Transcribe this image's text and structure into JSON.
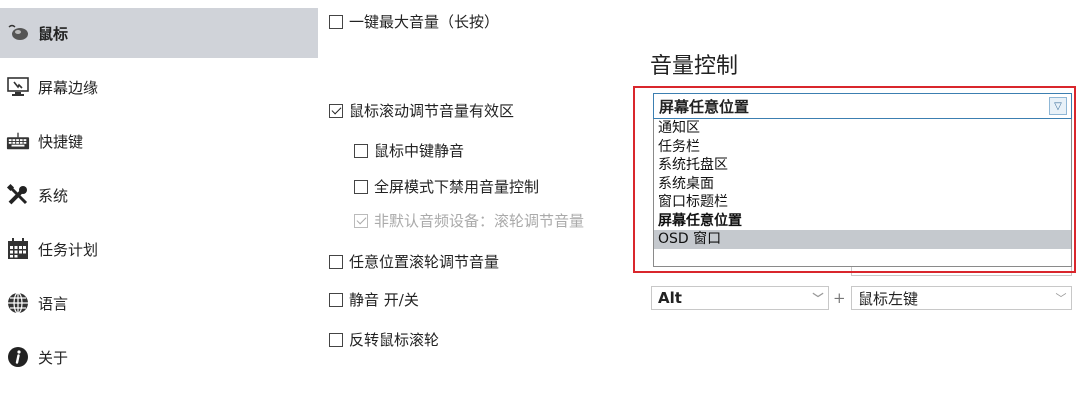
{
  "sidebar": {
    "items": [
      {
        "label": "鼠标",
        "icon": "mouse-icon",
        "active": true
      },
      {
        "label": "屏幕边缘",
        "icon": "monitor-icon",
        "active": false
      },
      {
        "label": "快捷键",
        "icon": "keyboard-icon",
        "active": false
      },
      {
        "label": "系统",
        "icon": "tools-icon",
        "active": false
      },
      {
        "label": "任务计划",
        "icon": "calendar-icon",
        "active": false
      },
      {
        "label": "语言",
        "icon": "globe-icon",
        "active": false
      },
      {
        "label": "关于",
        "icon": "info-icon",
        "active": false
      }
    ]
  },
  "main": {
    "top_option": {
      "label": "一键最大音量（长按）",
      "checked": false
    },
    "section_title": "音量控制",
    "scroll_zone": {
      "label": "鼠标滚动调节音量有效区",
      "checked": true
    },
    "middle_mute": {
      "label": "鼠标中键静音",
      "checked": false
    },
    "fullscreen_disable": {
      "label": "全屏模式下禁用音量控制",
      "checked": false
    },
    "non_default_device": {
      "label": "非默认音频设备：滚轮调节音量",
      "checked": true,
      "disabled": true
    },
    "anywhere_scroll": {
      "label": "任意位置滚轮调节音量",
      "checked": false
    },
    "mute_toggle": {
      "label": "静音 开/关",
      "checked": false
    },
    "reverse_scroll": {
      "label": "反转鼠标滚轮",
      "checked": false
    },
    "mute_modifier": "Alt",
    "mute_plus": "+",
    "mute_button": "鼠标左键"
  },
  "dropdown": {
    "selected": "屏幕任意位置",
    "options": [
      "通知区",
      "任务栏",
      "系统托盘区",
      "系统桌面",
      "窗口标题栏",
      "屏幕任意位置",
      "OSD 窗口"
    ],
    "highlighted": "OSD 窗口",
    "bold_option": "屏幕任意位置"
  },
  "colors": {
    "sidebar_active": "#d0d3d9",
    "highlight_border": "#d9262c",
    "combo_border": "#3c7fb1"
  }
}
